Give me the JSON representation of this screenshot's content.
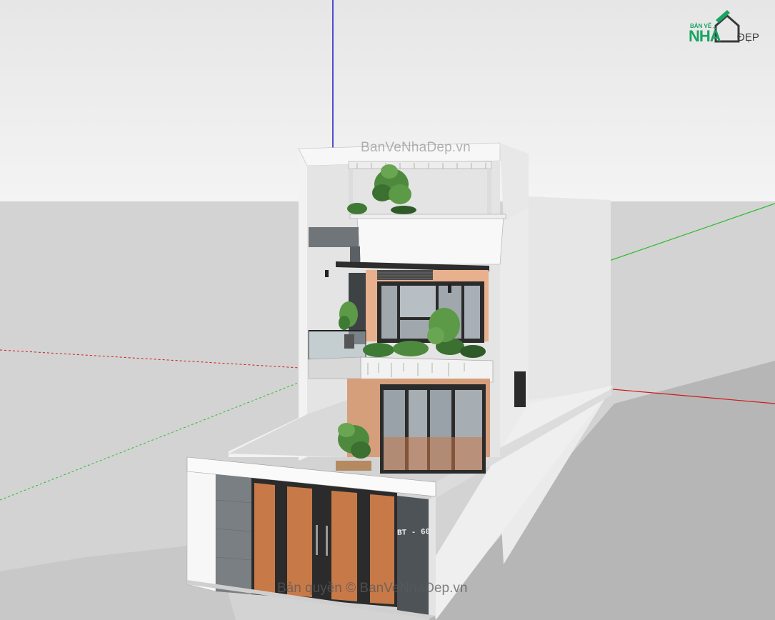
{
  "watermark_top": "BanVeNhaDep.vn",
  "watermark_bottom": "Bản quyền © BanVeNhaDep.vn",
  "logo": {
    "line1": "BẢN VẼ",
    "line2": "NHÀ",
    "line3": "ĐẸP"
  },
  "house_number_plate": "BT - 60",
  "colors": {
    "sky": "#ededed",
    "ground": "#d4d4d4",
    "wall_white": "#f5f5f5",
    "wall_shadow": "#e2e2e2",
    "wood": "#c87948",
    "glass": "#8f9aa3",
    "stone": "#7a7f83",
    "plant": "#3f7a35",
    "shadow": "#b4b4b4",
    "axis_red": "#d11a1a",
    "axis_green": "#2cba2c",
    "axis_blue": "#1a1acc"
  }
}
